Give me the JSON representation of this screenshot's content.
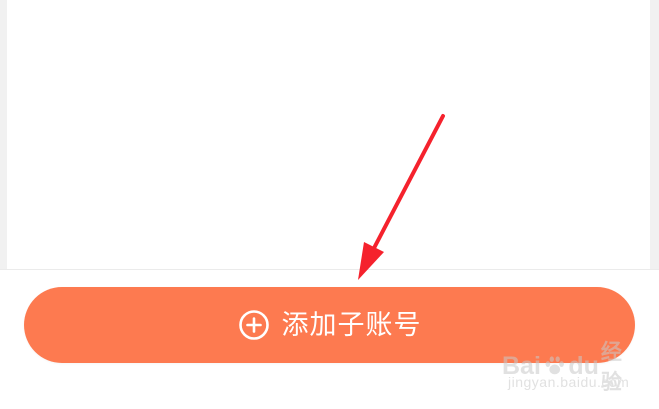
{
  "add_button": {
    "label": "添加子账号",
    "icon": "plus-circle-icon",
    "background_color": "#fd7a50",
    "text_color": "#ffffff"
  },
  "annotation": {
    "icon": "arrow-icon",
    "color": "#f5222d"
  },
  "watermark": {
    "brand_text": "Bai",
    "brand_text_2": "du",
    "brand_cn": "经验",
    "url": "jingyan.baidu.com"
  }
}
